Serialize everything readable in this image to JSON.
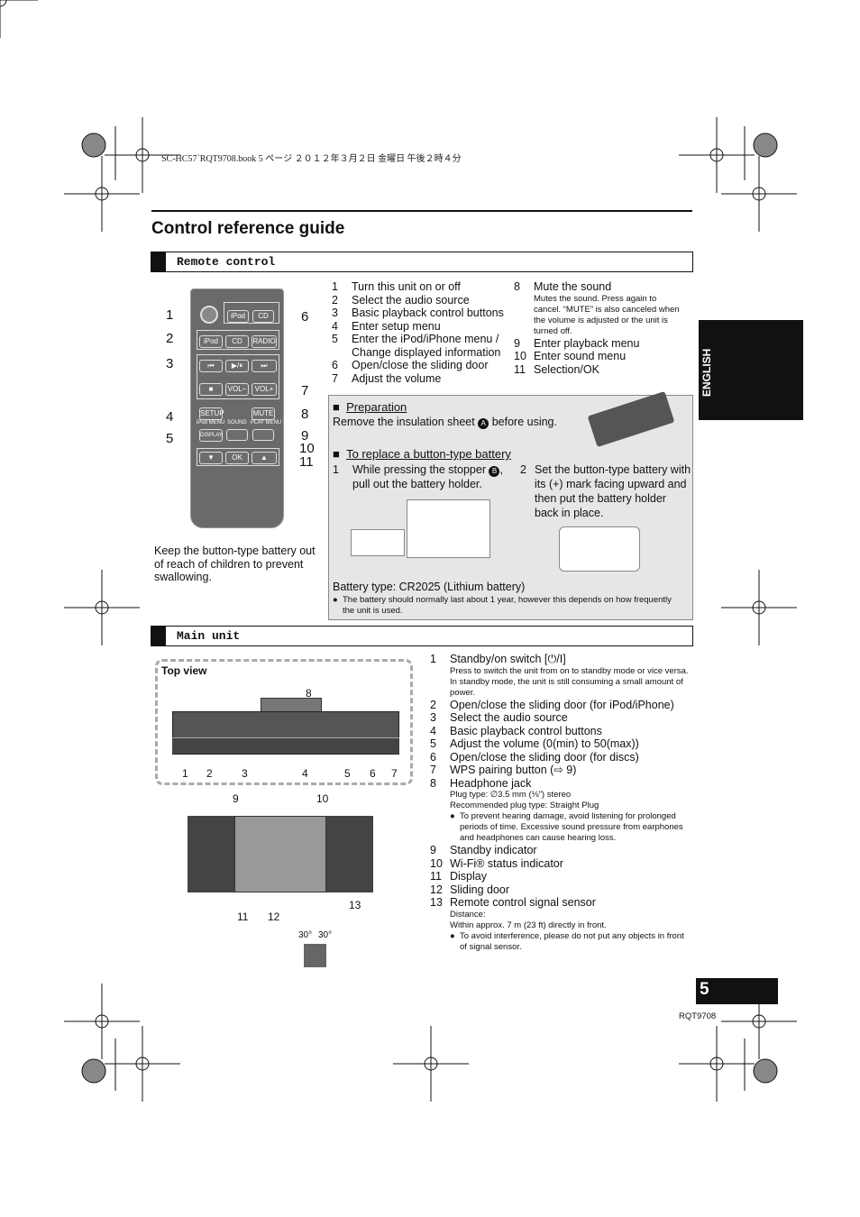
{
  "header": "SC-HC57`RQT9708.book  5 ページ  ２０１２年３月２日  金曜日  午後２時４分",
  "title": "Control reference guide",
  "remote_section": "Remote control",
  "main_section": "Main unit",
  "remote_labels": [
    "1",
    "2",
    "3",
    "4",
    "5",
    "6",
    "7",
    "8",
    "9",
    "10",
    "11"
  ],
  "remote_buttons": {
    "ipod_eject": "iPod",
    "cd_eject": "CD",
    "ipod": "iPod",
    "cd": "CD",
    "radio": "RADIO",
    "stop": "■",
    "vol_down": "VOL−",
    "vol_up": "VOL+",
    "setup": "SETUP",
    "mute": "MUTE",
    "ipod_menu": "iPod MENU",
    "display": "DISPLAY",
    "sound": "SOUND",
    "play_menu": "PLAY MENU",
    "down": "▼",
    "ok": "OK",
    "up": "▲"
  },
  "remote_items_left": [
    {
      "n": "1",
      "t": "Turn this unit on or off"
    },
    {
      "n": "2",
      "t": "Select the audio source"
    },
    {
      "n": "3",
      "t": "Basic playback control buttons"
    },
    {
      "n": "4",
      "t": "Enter setup menu"
    },
    {
      "n": "5",
      "t": "Enter the iPod/iPhone menu / Change displayed information"
    },
    {
      "n": "6",
      "t": "Open/close the sliding door"
    },
    {
      "n": "7",
      "t": "Adjust the volume"
    }
  ],
  "remote_items_right": {
    "item8": "Mute the sound",
    "item8_note": "Mutes the sound. Press again to cancel. “MUTE” is also canceled when the volume is adjusted or the unit is turned off.",
    "others": [
      {
        "n": "9",
        "t": "Enter playback menu"
      },
      {
        "n": "10",
        "t": "Enter sound menu"
      },
      {
        "n": "11",
        "t": "Selection/OK"
      }
    ]
  },
  "child_warning": "Keep the button-type battery out of reach of children to prevent swallowing.",
  "preparation": {
    "heading": "Preparation",
    "text_before": "Remove the insulation sheet",
    "marker": "A",
    "text_after": "before using."
  },
  "battery": {
    "heading": "To replace a button-type battery",
    "step1": "While pressing the stopper",
    "step1_marker": "B",
    "step1_rest": ", pull out the battery holder.",
    "step2": "Set the button-type battery with its (+) mark facing upward and then put the battery holder back in place.",
    "type": "Battery type: CR2025 (Lithium battery)",
    "note": "The battery should normally last about 1 year, however this depends on how frequently the unit is used."
  },
  "top_view": "Top view",
  "top_labels": [
    "1",
    "2",
    "3",
    "4",
    "5",
    "6",
    "7",
    "8"
  ],
  "front_labels": [
    "9",
    "10",
    "11",
    "12",
    "13"
  ],
  "angles": [
    "30°",
    "30°"
  ],
  "main_items": [
    {
      "n": "1",
      "t": "Standby/on switch [⏻/I]",
      "notes": [
        "Press to switch the unit from on to standby mode or vice versa.",
        "In standby mode, the unit is still consuming a small amount of power."
      ]
    },
    {
      "n": "2",
      "t": "Open/close the sliding door (for iPod/iPhone)"
    },
    {
      "n": "3",
      "t": "Select the audio source"
    },
    {
      "n": "4",
      "t": "Basic playback control buttons"
    },
    {
      "n": "5",
      "t": "Adjust the volume (0(min) to 50(max))"
    },
    {
      "n": "6",
      "t": "Open/close the sliding door (for discs)"
    },
    {
      "n": "7",
      "t": "WPS pairing button (⇨ 9)"
    },
    {
      "n": "8",
      "t": "Headphone jack",
      "notes": [
        "Plug type: ∅3.5 mm (⅛\") stereo",
        "Recommended plug type: Straight Plug"
      ],
      "bullet": "To prevent hearing damage, avoid listening for prolonged periods of time. Excessive sound pressure from earphones and headphones can cause hearing loss."
    },
    {
      "n": "9",
      "t": "Standby indicator"
    },
    {
      "n": "10",
      "t": "Wi-Fi® status indicator"
    },
    {
      "n": "11",
      "t": "Display"
    },
    {
      "n": "12",
      "t": "Sliding door"
    },
    {
      "n": "13",
      "t": "Remote control signal sensor",
      "notes": [
        "Distance:",
        "Within approx. 7 m (23 ft) directly in front."
      ],
      "bullet": "To avoid interference, please do not put any objects in front of signal sensor."
    }
  ],
  "side_tab": "ENGLISH",
  "page_number": "5",
  "doc_code": "RQT9708"
}
